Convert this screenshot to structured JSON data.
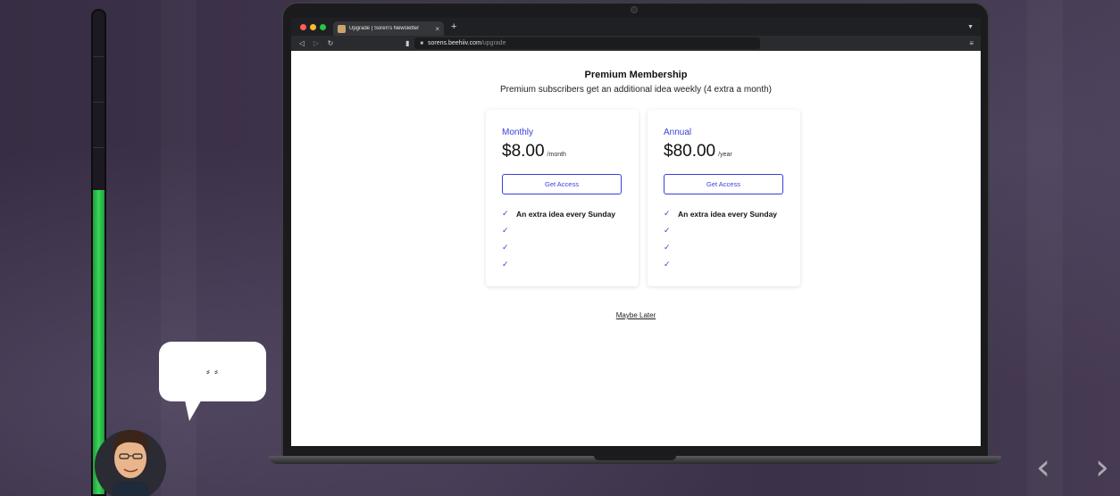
{
  "browser": {
    "tab_title": "Upgrade | Soren's Newsletter",
    "tab_close": "×",
    "new_tab": "+",
    "url_host": "sorens.beehiiv.com",
    "url_path": "/upgrade",
    "traffic_lights": [
      "#ff5f57",
      "#febc2e",
      "#28c840"
    ]
  },
  "page": {
    "title": "Premium Membership",
    "subtitle": "Premium subscribers get an additional idea weekly (4 extra a month)",
    "plans": [
      {
        "name": "Monthly",
        "price": "$8.00",
        "period": "/month",
        "cta": "Get Access",
        "features": [
          "An extra idea every Sunday",
          "",
          "",
          ""
        ]
      },
      {
        "name": "Annual",
        "price": "$80.00",
        "period": "/year",
        "cta": "Get Access",
        "features": [
          "An extra idea every Sunday",
          "",
          "",
          ""
        ]
      }
    ],
    "maybe_later": "Maybe Later",
    "accent_color": "#3a3fd8"
  },
  "overlay": {
    "bubble_text": "⸗ ⸗",
    "meter_level": 0.63,
    "meter_color": "#3ad65a"
  },
  "slides": {
    "prev": "‹",
    "next": "›"
  }
}
